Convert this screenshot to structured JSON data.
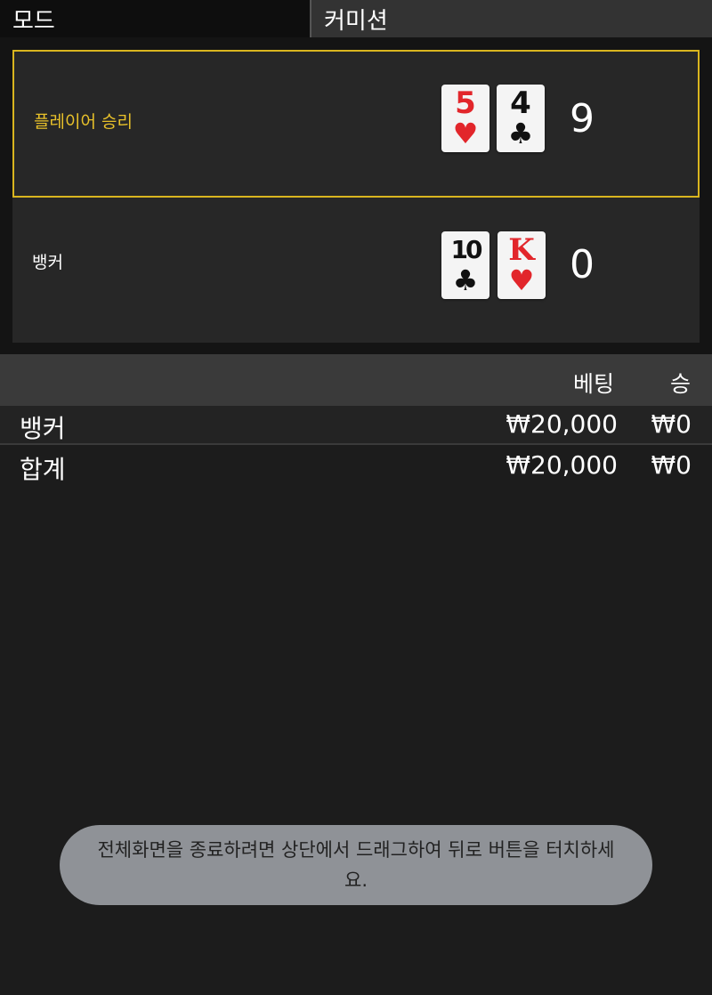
{
  "topbar": {
    "mode_label": "모드",
    "commission_label": "커미션"
  },
  "results": {
    "player": {
      "label": "플레이어 승리",
      "cards": [
        {
          "rank": "5",
          "suit": "♥",
          "color": "#e2262b"
        },
        {
          "rank": "4",
          "suit": "♣",
          "color": "#111111"
        }
      ],
      "score": "9"
    },
    "banker": {
      "label": "뱅커",
      "cards": [
        {
          "rank": "10",
          "suit": "♣",
          "color": "#111111"
        },
        {
          "rank": "K",
          "suit": "♥",
          "color": "#e2262b"
        }
      ],
      "score": "0"
    }
  },
  "bets": {
    "header": {
      "bet": "베팅",
      "win": "승"
    },
    "rows": [
      {
        "name": "뱅커",
        "bet": "₩20,000",
        "win": "₩0"
      },
      {
        "name": "합계",
        "bet": "₩20,000",
        "win": "₩0"
      }
    ]
  },
  "toast": {
    "message": "전체화면을 종료하려면 상단에서 드래그하여 뒤로 버튼을 터치하세요."
  },
  "colors": {
    "highlight": "#d9b51f",
    "winner_text": "#e8c12a",
    "red_suit": "#e2262b"
  }
}
